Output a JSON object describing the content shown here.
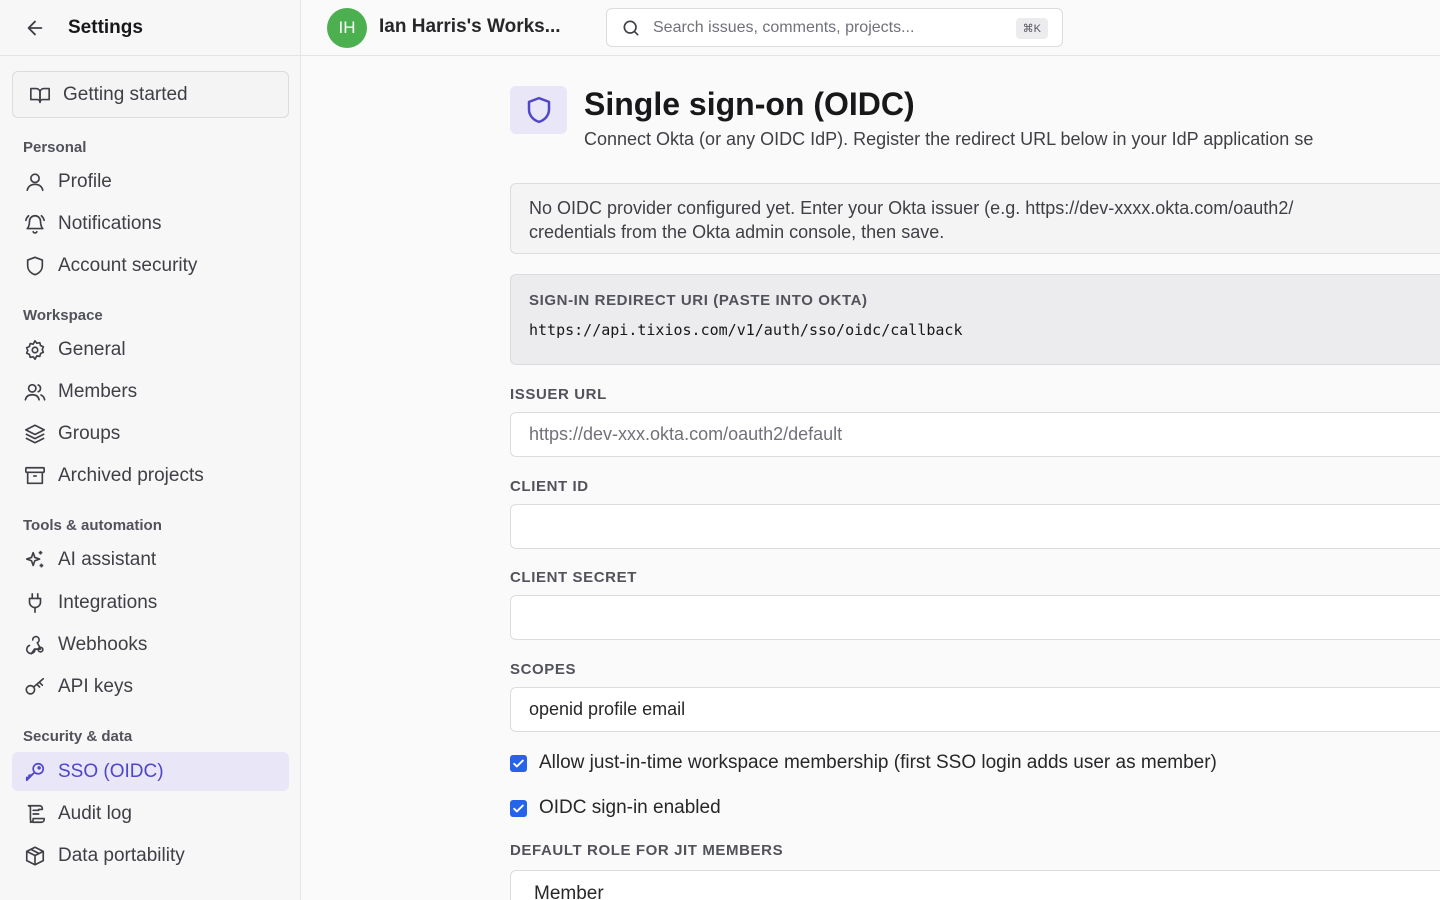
{
  "sidebar": {
    "title": "Settings",
    "getting_started": "Getting started",
    "sections": {
      "personal": "Personal",
      "workspace": "Workspace",
      "tools": "Tools & automation",
      "security": "Security & data"
    },
    "items": {
      "profile": "Profile",
      "notifications": "Notifications",
      "account_security": "Account security",
      "general": "General",
      "members": "Members",
      "groups": "Groups",
      "archived_projects": "Archived projects",
      "ai_assistant": "AI assistant",
      "integrations": "Integrations",
      "webhooks": "Webhooks",
      "api_keys": "API keys",
      "sso": "SSO (OIDC)",
      "audit_log": "Audit log",
      "data_portability": "Data portability"
    },
    "active_item": "sso"
  },
  "topbar": {
    "avatar_initials": "IH",
    "avatar_color": "#4caf50",
    "workspace_name": "Ian Harris's Works...",
    "search_placeholder": "Search issues, comments, projects...",
    "search_shortcut": "⌘K"
  },
  "main": {
    "title": "Single sign-on (OIDC)",
    "subtitle": "Connect Okta (or any OIDC IdP). Register the redirect URL below in your IdP application se",
    "notice_line1": "No OIDC provider configured yet. Enter your Okta issuer (e.g. https://dev-xxxx.okta.com/oauth2/",
    "notice_line2": "credentials from the Okta admin console, then save.",
    "redirect_label": "SIGN-IN REDIRECT URI (PASTE INTO OKTA)",
    "redirect_uri": "https://api.tixios.com/v1/auth/sso/oidc/callback",
    "fields": {
      "issuer_label": "ISSUER URL",
      "issuer_placeholder": "https://dev-xxx.okta.com/oauth2/default",
      "issuer_value": "",
      "client_id_label": "CLIENT ID",
      "client_id_value": "",
      "client_secret_label": "CLIENT SECRET",
      "client_secret_value": "",
      "scopes_label": "SCOPES",
      "scopes_value": "openid profile email"
    },
    "jit_checkbox_label": "Allow just-in-time workspace membership (first SSO login adds user as member)",
    "jit_checked": true,
    "enabled_checkbox_label": "OIDC sign-in enabled",
    "enabled_checked": true,
    "default_role_label": "DEFAULT ROLE FOR JIT MEMBERS",
    "default_role_value": "Member"
  },
  "colors": {
    "accent": "#4f46c8",
    "accent_bg": "#e8e6f7",
    "checkbox": "#2563eb"
  }
}
